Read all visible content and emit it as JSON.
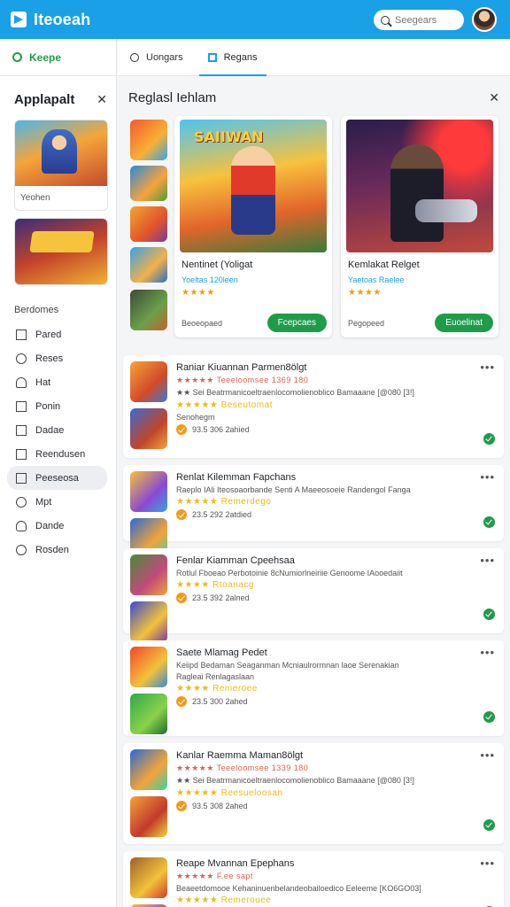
{
  "app": {
    "title": "Iteoeah"
  },
  "search": {
    "placeholder": "Seegears"
  },
  "sidebar": {
    "tab_label": "Keepe",
    "title": "Applapalt",
    "card1_caption": "Yeohen",
    "section_label": "Berdomes",
    "items": [
      {
        "label": "Pared",
        "icon": "home-icon"
      },
      {
        "label": "Reses",
        "icon": "globe-icon"
      },
      {
        "label": "Hat",
        "icon": "bell-icon"
      },
      {
        "label": "Ponin",
        "icon": "tag-icon"
      },
      {
        "label": "Dadae",
        "icon": "grid-icon"
      },
      {
        "label": "Reendusen",
        "icon": "chart-icon"
      },
      {
        "label": "Peeseosa",
        "icon": "edit-icon"
      },
      {
        "label": "Mpt",
        "icon": "chat-icon"
      },
      {
        "label": "Dande",
        "icon": "person-icon"
      },
      {
        "label": "Rosden",
        "icon": "power-icon"
      }
    ]
  },
  "tabs": [
    {
      "label": "Uongars",
      "icon": "search-icon"
    },
    {
      "label": "Regans",
      "icon": "square-icon",
      "active": true
    }
  ],
  "panel": {
    "title": "Reglasl Iehlam",
    "featured": [
      {
        "art_title": "SAIIWAN",
        "title": "Nentinet (Yoligat",
        "subtitle": "Yoeltas  120leen",
        "stars": "★★★★",
        "footer": "Beoeopaed",
        "button": "Fcepcaes"
      },
      {
        "title": "Kemlakat Relget",
        "subtitle": "Yaetoas  Raelee",
        "stars": "★★★★",
        "footer": "Pegopeed",
        "button": "Euoelinat"
      }
    ],
    "list": [
      {
        "title": "Raniar Kiuannan Parmen8ölgt",
        "lines": [
          {
            "text": "★★★★★  Teeeloomsee  1369 180",
            "cls": "s1"
          },
          {
            "text": "★★ Sei Beatrmanicoeltraenlocomolienoblico Bamaaane [@080 [3!]",
            "cls": "line"
          },
          {
            "text": "★★★★★  Beseutomat",
            "cls": "s2"
          },
          {
            "text": "Senohegm",
            "cls": "line"
          }
        ],
        "meta": "93.5 306 2ahied"
      },
      {
        "title": "Renlat Kilemman Fapchans",
        "lines": [
          {
            "text": "Raeplo IAli Iteosoaorbande Senti A Maeeosoeie Randengol Fanga",
            "cls": "line"
          },
          {
            "text": "★★★★★  Remerdego",
            "cls": "s2"
          }
        ],
        "meta": "23.5 292 2atdied"
      },
      {
        "title": "Fenlar Kiamman Cpeehsaa",
        "lines": [
          {
            "text": "Rotlul Fboeao Perbotoinie 8cNumiorlneiriie Genoome IAooedaiit",
            "cls": "line"
          },
          {
            "text": "★★★★  Rtoanacg",
            "cls": "s2"
          }
        ],
        "meta": "23.5 392 2alned"
      },
      {
        "title": "Saete Mlamag Pedet",
        "lines": [
          {
            "text": "Keiipd Bedaman  Seaganman Mcniaulrormnan laoe Serenakian",
            "cls": "line"
          },
          {
            "text": "Ragleai Renlagaslaan",
            "cls": "line"
          },
          {
            "text": "★★★★  Remeroee",
            "cls": "s2"
          }
        ],
        "meta": "23.5 300 2ahed"
      },
      {
        "title": "Kanlar Raemma Maman8ölgt",
        "lines": [
          {
            "text": "★★★★★  Teeeloomsee  1339 180",
            "cls": "s1"
          },
          {
            "text": "★★ Sei Beatrmanicoeltraenlocomolienoblico Bamaaane [@080 [3!]",
            "cls": "line"
          },
          {
            "text": "★★★★★  Reesueloosan",
            "cls": "s2"
          }
        ],
        "meta": "93.5 308 2ahed"
      },
      {
        "title": "Reape Mvannan Epephans",
        "lines": [
          {
            "text": "★★★★★  F.ee sapt",
            "cls": "s1"
          },
          {
            "text": "Beaeetdomooe Kehaninuenbelandeobailoedico Eeleeme [KO6GO03]",
            "cls": "line"
          },
          {
            "text": "★★★★★  Remerouee",
            "cls": "s2"
          }
        ],
        "meta": ""
      }
    ]
  },
  "colors": {
    "brand": "#1aa0e6",
    "accent": "#1f9c4a",
    "star": "#f29a1a"
  }
}
